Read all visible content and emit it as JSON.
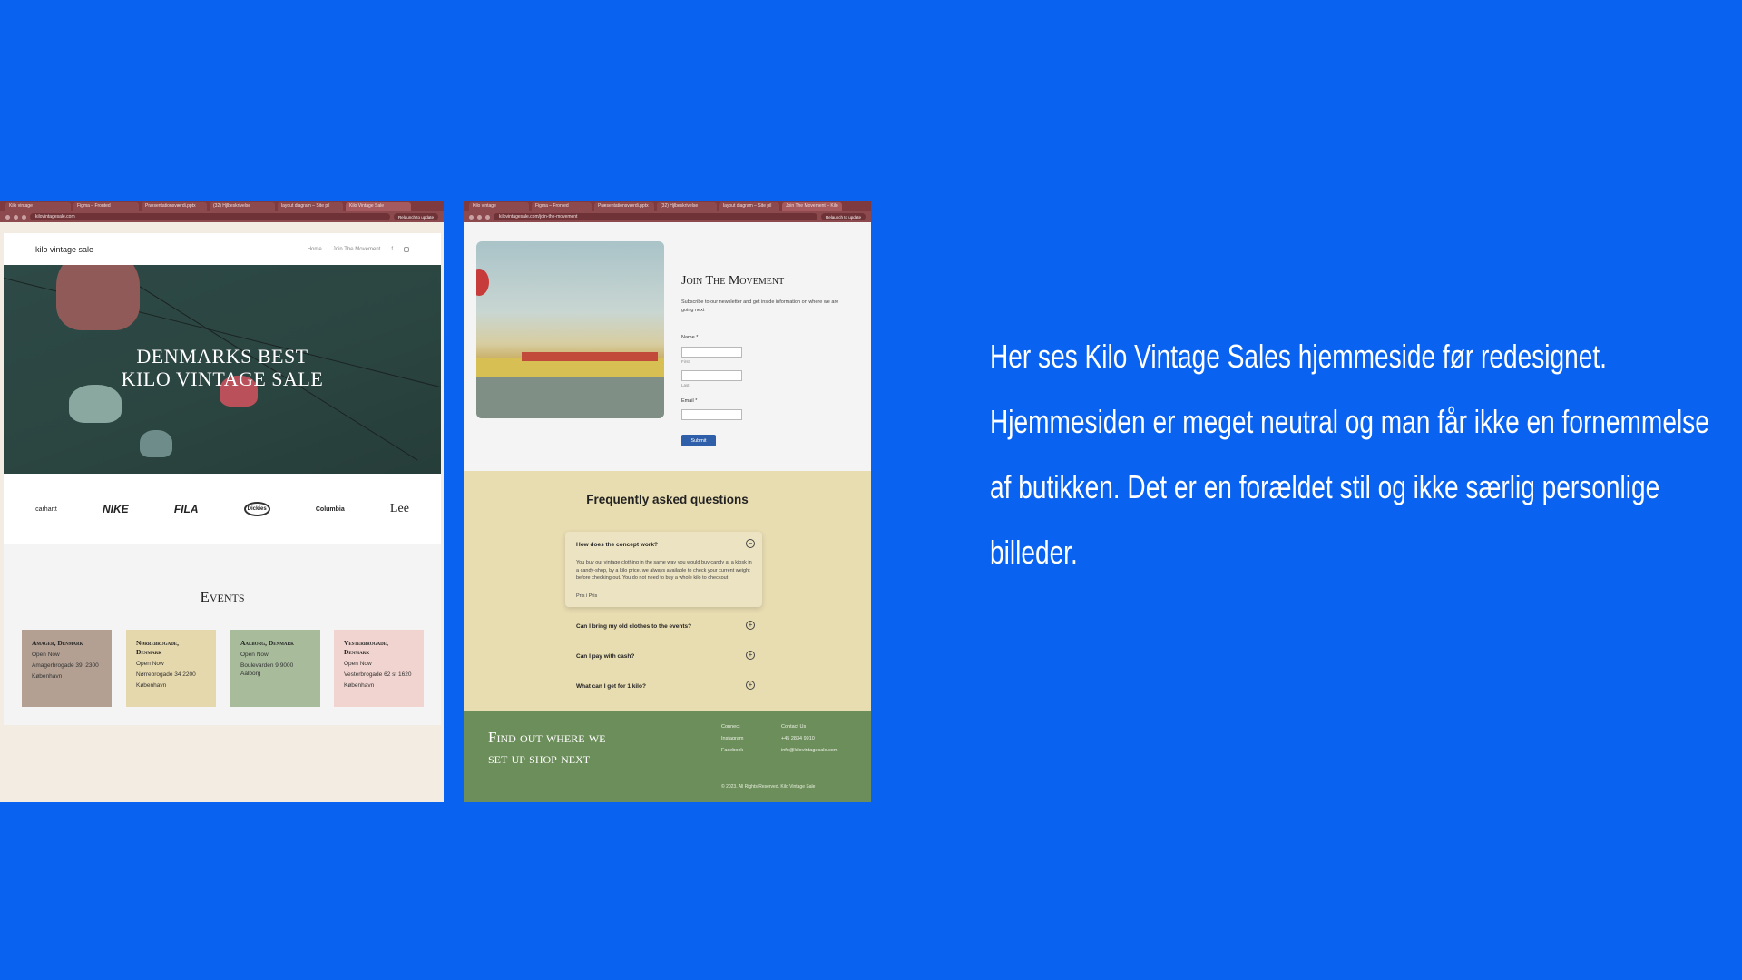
{
  "colors": {
    "background": "#0a62f0",
    "browser_chrome": "#7e3a3e",
    "faq_bg": "#e8dcb1",
    "footer_bg": "#6c8e5a",
    "submit": "#2f5fa8"
  },
  "left_shot": {
    "tabs": [
      "Kilo vintage",
      "Figma – Fronted",
      "Præsentationsværdi.pptx",
      "(32) Hjlbeskrivelse",
      "layout diagram – Site pil",
      "Kilo Vintage Sale"
    ],
    "url": "kilovintagesale.com",
    "toolbar_button": "Relaunch to update",
    "logo": "kilo vintage sale",
    "nav": [
      "Home",
      "Join The Movement"
    ],
    "nav_icons": [
      "facebook-icon",
      "instagram-icon"
    ],
    "hero_title_line1": "DENMARKS BEST",
    "hero_title_line2": "KILO VINTAGE SALE",
    "brands": [
      "carhartt",
      "NIKE",
      "FILA",
      "Dickies",
      "Columbia",
      "Lee"
    ],
    "events_title": "Events",
    "events": [
      {
        "name": "Amager, Denmark",
        "status": "Open Now",
        "address": "Amagerbrogade 39, 2300",
        "extra": "København",
        "color": "#b3a092"
      },
      {
        "name": "Nørrebrogade, Denmark",
        "status": "Open Now",
        "address": "Nørrebrogade 34 2200",
        "extra": "København",
        "color": "#e6d8ad"
      },
      {
        "name": "Aalborg, Denmark",
        "status": "Open Now",
        "address": "Boulevarden 9 9000 Aalborg",
        "extra": "",
        "color": "#a8bc9c"
      },
      {
        "name": "Vesterbrogade, Denmark",
        "status": "Open Now",
        "address": "Vesterbrogade 62 st 1620",
        "extra": "København",
        "color": "#f1d4cf"
      }
    ]
  },
  "right_shot": {
    "tabs": [
      "Kilo vintage",
      "Figma – Fronted",
      "Præsentationsværdi.pptx",
      "(32) Hjlbeskrivelse",
      "layout diagram – Site pil",
      "Join The Movement – Kilo"
    ],
    "url": "kilovintagesale.com/join-the-movement",
    "toolbar_button": "Relaunch to update",
    "join_title": "Join The Movement",
    "join_subtitle": "Subscribe to our newsletter and get inside information on where we are going next",
    "form": {
      "name_label": "Name *",
      "first_label": "First",
      "last_label": "Last",
      "email_label": "Email *",
      "submit_label": "Submit"
    },
    "faq_title": "Frequently asked questions",
    "faq": [
      {
        "q": "How does the concept work?",
        "a": "You buy our vintage clothing in the same way you would buy candy at a kiosk in a candy-shop, by a kilo price. we always available to check your current weight before checking out. You do not need to buy a whole kilo to checkout",
        "more": "Pris i Pris",
        "icon": "−"
      },
      {
        "q": "Can I bring my old clothes to the events?",
        "icon": "+"
      },
      {
        "q": "Can I pay with cash?",
        "icon": "+"
      },
      {
        "q": "What can I get for 1 kilo?",
        "icon": "+"
      }
    ],
    "footer": {
      "title_line1": "Find out where we",
      "title_line2": "set up shop next",
      "connect_heading": "Connect",
      "connect_items": [
        "Instagram",
        "Facebook"
      ],
      "contact_heading": "Contact Us",
      "contact_items": [
        "+45 2834 9910",
        "info@kilovintagesale.com"
      ],
      "copyright": "© 2023. All Rights Reserved. Kilo Vintage Sale"
    }
  },
  "caption": [
    "Her ses Kilo Vintage Sales hjemmeside før redesignet.",
    "Hjemmesiden er meget neutral og man får ikke en fornemmelse",
    "af butikken.  Det er en forældet stil og ikke særlig personlige",
    "billeder."
  ]
}
